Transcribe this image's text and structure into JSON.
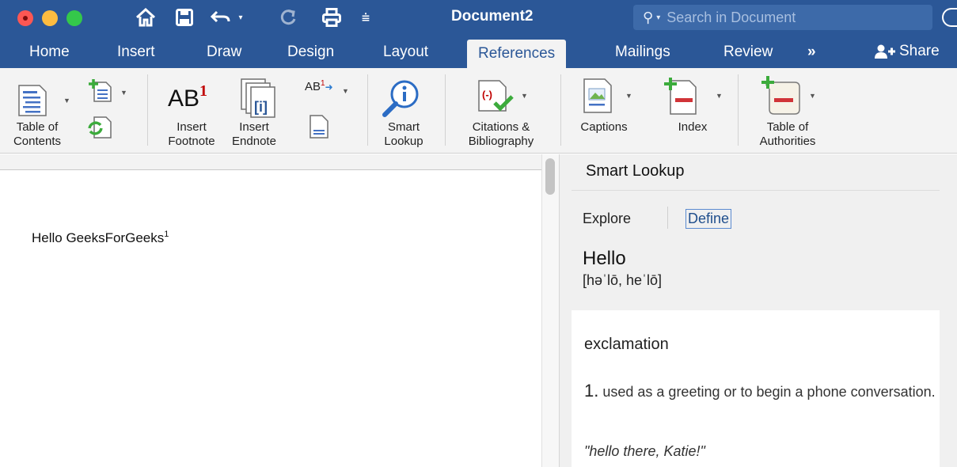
{
  "titlebar": {
    "doc_title": "Document2",
    "search_placeholder": "Search in Document"
  },
  "tabs": [
    {
      "label": "Home"
    },
    {
      "label": "Insert"
    },
    {
      "label": "Draw"
    },
    {
      "label": "Design"
    },
    {
      "label": "Layout"
    },
    {
      "label": "References",
      "active": true
    },
    {
      "label": "Mailings"
    },
    {
      "label": "Review"
    }
  ],
  "tabs_more": "»",
  "share_label": "Share",
  "ribbon": {
    "toc_label_1": "Table of",
    "toc_label_2": "Contents",
    "ab_text": "AB",
    "ab_sup": "1",
    "insert_footnote_1": "Insert",
    "insert_footnote_2": "Footnote",
    "insert_endnote_1": "Insert",
    "insert_endnote_2": "Endnote",
    "next_footnote_text": "AB",
    "next_footnote_sup": "1",
    "smart_lookup_1": "Smart",
    "smart_lookup_2": "Lookup",
    "citations_1": "Citations &",
    "citations_2": "Bibliography",
    "captions": "Captions",
    "index": "Index",
    "toa_1": "Table of",
    "toa_2": "Authorities"
  },
  "document": {
    "text": "Hello GeeksForGeeks",
    "footnote_ref": "1"
  },
  "smart_lookup": {
    "title": "Smart Lookup",
    "tab_explore": "Explore",
    "tab_define": "Define",
    "word": "Hello",
    "pronunciation": "[həˈlō, heˈlō]",
    "part_of_speech": "exclamation",
    "sense_number": "1.",
    "sense_text": "used as a greeting or to begin a phone conversation.",
    "example": "\"hello there, Katie!\""
  },
  "colors": {
    "brand_blue": "#2b5797",
    "ribbon_bg": "#f3f3f3"
  }
}
